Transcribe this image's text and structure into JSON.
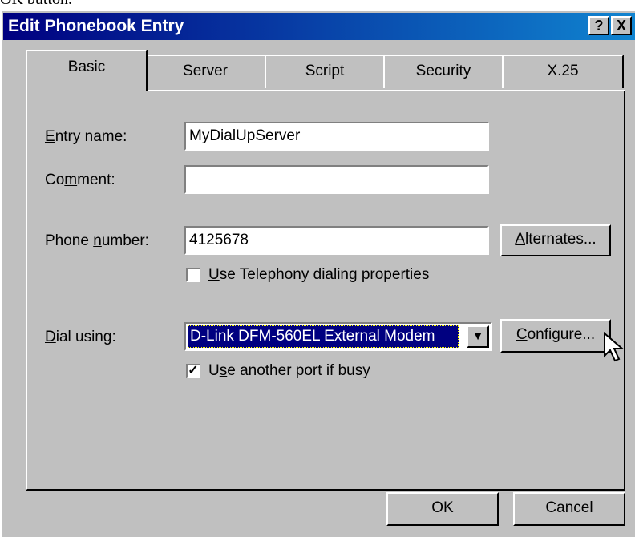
{
  "clipped_text": "OK button.",
  "window": {
    "title": "Edit Phonebook Entry",
    "help_glyph": "?",
    "close_glyph": "X"
  },
  "tabs": [
    {
      "label": "Basic",
      "active": true
    },
    {
      "label": "Server",
      "active": false
    },
    {
      "label": "Script",
      "active": false
    },
    {
      "label": "Security",
      "active": false
    },
    {
      "label": "X.25",
      "active": false
    }
  ],
  "form": {
    "entry_name": {
      "label_pre": "",
      "label_u": "E",
      "label_post": "ntry name:",
      "value": "MyDialUpServer"
    },
    "comment": {
      "label_pre": "Co",
      "label_u": "m",
      "label_post": "ment:",
      "value": ""
    },
    "phone": {
      "label_pre": "Phone ",
      "label_u": "n",
      "label_post": "umber:",
      "value": "4125678"
    },
    "alternates_button": {
      "u": "A",
      "rest": "lternates..."
    },
    "use_telephony": {
      "u": "U",
      "rest": "se Telephony dialing properties",
      "checked": false
    },
    "dial_using": {
      "label_pre": "",
      "label_u": "D",
      "label_post": "ial using:",
      "value": "D-Link DFM-560EL External Modem"
    },
    "configure_button": {
      "u": "C",
      "rest": "onfigure..."
    },
    "use_another_port": {
      "pre": "U",
      "u": "s",
      "rest": "e another port if busy",
      "checked": true
    }
  },
  "footer": {
    "ok_label": "OK",
    "cancel_label": "Cancel"
  },
  "colors": {
    "titlebar_start": "#000080",
    "titlebar_end": "#1084d0",
    "face": "#c0c0c0",
    "selection": "#000080"
  }
}
